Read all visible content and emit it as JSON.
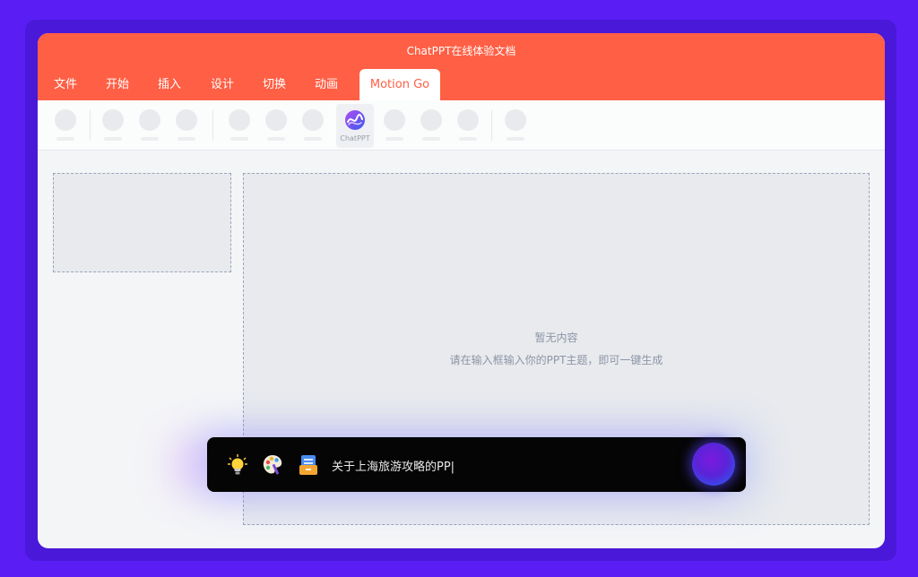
{
  "window": {
    "title": "ChatPPT在线体验文档"
  },
  "tabs": [
    {
      "label": "文件"
    },
    {
      "label": "开始"
    },
    {
      "label": "插入"
    },
    {
      "label": "设计"
    },
    {
      "label": "切换"
    },
    {
      "label": "动画"
    },
    {
      "label": "Motion Go",
      "active": true
    }
  ],
  "toolbar": {
    "chatppt_label": "ChatPPT"
  },
  "canvas": {
    "empty_title": "暂无内容",
    "empty_hint": "请在输入框输入你的PPT主题，即可一键生成"
  },
  "input_bar": {
    "value": "关于上海旅游攻略的PP|",
    "icons": [
      "lightbulb-icon",
      "palette-icon",
      "document-edit-icon",
      "send-orb-icon"
    ]
  },
  "colors": {
    "background": "#5a1ef5",
    "titlebar": "#ff5f45",
    "active_tab_text": "#ff5f45",
    "input_bar": "#050505"
  }
}
